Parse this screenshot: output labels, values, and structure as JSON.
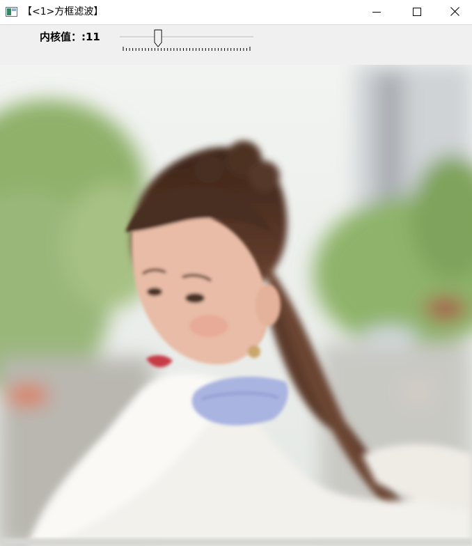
{
  "window": {
    "title": "【<1>方框滤波】",
    "icon": "opencv-window-icon",
    "controls": [
      "minimize-icon",
      "maximize-icon",
      "close-icon"
    ]
  },
  "trackbar": {
    "label": "内核值：:11",
    "value": 11,
    "min": 0,
    "max": 40
  },
  "image": {
    "description_icon": "photo-canvas",
    "colors": {
      "background_greenery": "#9cb97a",
      "sky": "#e8ece8",
      "hair": "#4a2e20",
      "skin": "#e6b9a3",
      "hoodie": "#f3f1ec",
      "headphones": "#aab4e0"
    }
  }
}
